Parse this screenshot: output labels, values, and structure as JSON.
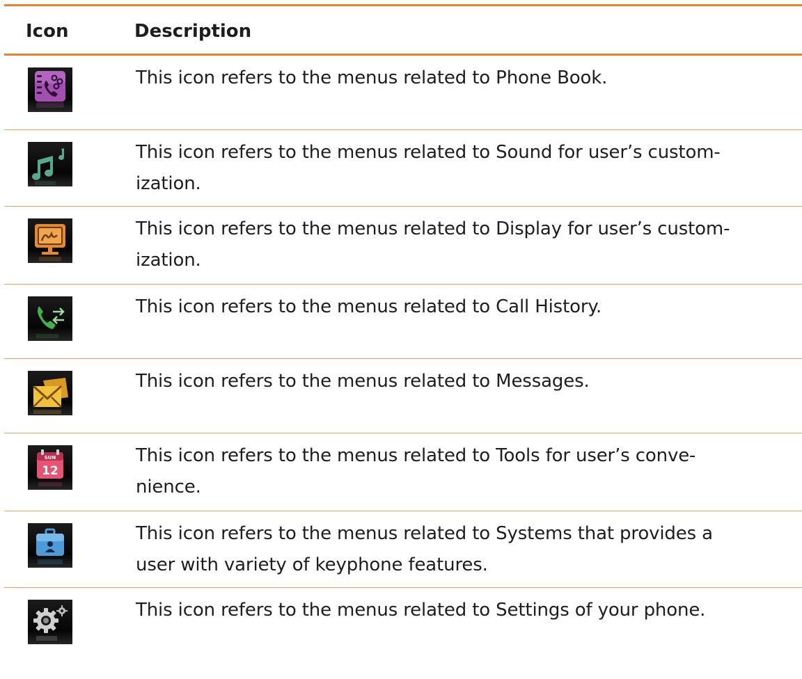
{
  "header": {
    "icon_label": "Icon",
    "description_label": "Description"
  },
  "colors": {
    "rule": "#e8822b",
    "row_divider": "#e9a25f"
  },
  "rows": [
    {
      "icon": "phone-book-icon",
      "line1": "This icon refers to the menus related to Phone Book.",
      "line2": ""
    },
    {
      "icon": "sound-icon",
      "line1": "This icon refers to the menus related to Sound for user’s custom-",
      "line2": "ization."
    },
    {
      "icon": "display-icon",
      "line1": "This icon refers to the menus related to Display for user’s custom-",
      "line2": "ization."
    },
    {
      "icon": "call-history-icon",
      "line1": "This icon refers to the menus related to Call History.",
      "line2": ""
    },
    {
      "icon": "messages-icon",
      "line1": "This icon refers to the menus related to Messages.",
      "line2": ""
    },
    {
      "icon": "tools-icon",
      "line1": "This icon refers to the menus related to Tools for user’s conve-",
      "line2": "nience.",
      "calendar_day": "SUN",
      "calendar_date": "12"
    },
    {
      "icon": "systems-icon",
      "line1": "This icon refers to the menus related to Systems that provides a",
      "line2": "user with variety of keyphone features."
    },
    {
      "icon": "settings-icon",
      "line1": "This icon refers to the menus related to Settings of your phone.",
      "line2": ""
    }
  ]
}
